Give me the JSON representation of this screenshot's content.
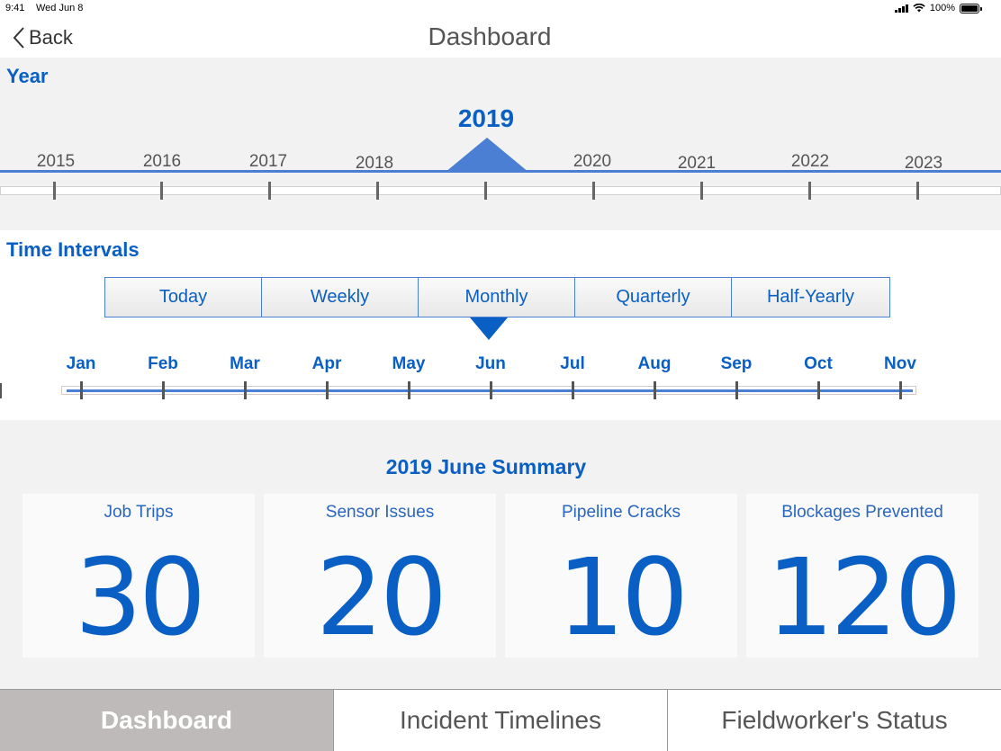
{
  "status": {
    "time": "9:41",
    "date": "Wed Jun 8",
    "battery": "100%"
  },
  "nav": {
    "back_label": "Back",
    "title": "Dashboard"
  },
  "year": {
    "section_title": "Year",
    "selected": "2019",
    "labels": [
      "2015",
      "2016",
      "2017",
      "2018",
      "2020",
      "2021",
      "2022",
      "2023"
    ]
  },
  "intervals": {
    "section_title": "Time Intervals",
    "tabs": [
      "Today",
      "Weekly",
      "Monthly",
      "Quarterly",
      "Half-Yearly"
    ],
    "selected_tab": "Monthly",
    "months": [
      "Jan",
      "Feb",
      "Mar",
      "Apr",
      "May",
      "Jun",
      "Jul",
      "Aug",
      "Sep",
      "Oct",
      "Nov"
    ],
    "selected_month": "Jun"
  },
  "summary": {
    "title": "2019 June Summary",
    "cards": [
      {
        "label": "Job Trips",
        "value": "30"
      },
      {
        "label": "Sensor Issues",
        "value": "20"
      },
      {
        "label": "Pipeline Cracks",
        "value": "10"
      },
      {
        "label": "Blockages Prevented",
        "value": "120"
      }
    ]
  },
  "bottom_tabs": [
    "Dashboard",
    "Incident Timelines",
    "Fieldworker's Status"
  ],
  "active_bottom_tab": "Dashboard",
  "colors": {
    "accent": "#0a5fc4",
    "line": "#4a7fd4",
    "active_tab_bg": "#bdbab9"
  }
}
